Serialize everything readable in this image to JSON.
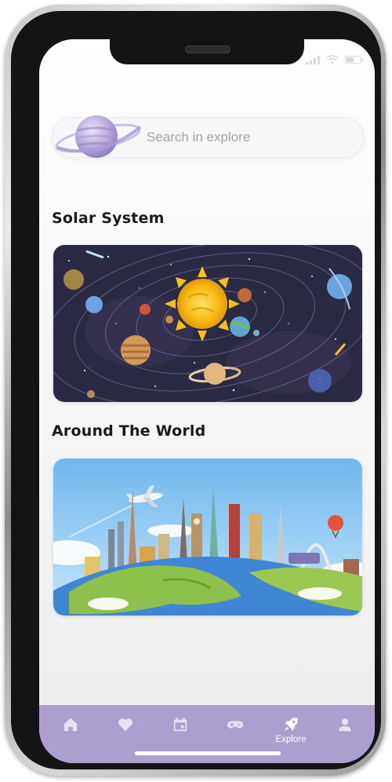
{
  "search": {
    "placeholder": "Search in explore"
  },
  "sections": [
    {
      "title": "Solar System",
      "image": "solar-system-illustration"
    },
    {
      "title": "Around The World",
      "image": "world-landmarks-illustration"
    }
  ],
  "bottom_nav": {
    "items": [
      {
        "icon": "home-icon",
        "label": ""
      },
      {
        "icon": "heart-icon",
        "label": ""
      },
      {
        "icon": "calendar-icon",
        "label": ""
      },
      {
        "icon": "gamepad-icon",
        "label": ""
      },
      {
        "icon": "rocket-icon",
        "label": "Explore",
        "active": true
      },
      {
        "icon": "user-icon",
        "label": ""
      }
    ]
  },
  "colors": {
    "nav_background": "#ac9ecf",
    "nav_icon": "#e7e1f3",
    "active": "#ffffff",
    "title_text": "#1a1a1a",
    "placeholder_text": "#a3a3a3"
  }
}
